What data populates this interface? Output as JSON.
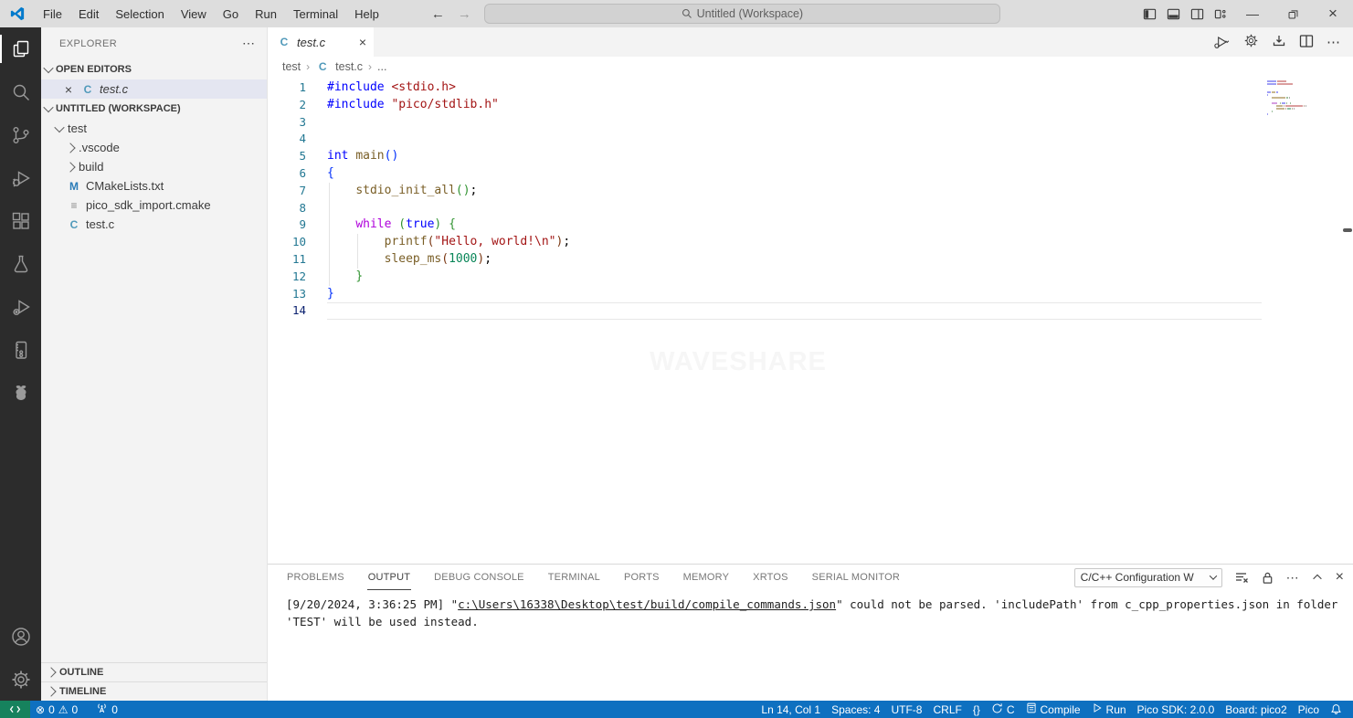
{
  "titlebar": {
    "menus": [
      "File",
      "Edit",
      "Selection",
      "View",
      "Go",
      "Run",
      "Terminal",
      "Help"
    ],
    "command_center": "Untitled (Workspace)"
  },
  "icons": {
    "search_glyph": "⌕",
    "more_horizontal": "⋯",
    "close": "×",
    "minimize": "—",
    "error": "⊗",
    "warning": "⚠",
    "braces": "{}",
    "run_play": "▷",
    "back_arrow": "←",
    "forward_arrow": "→"
  },
  "sidebar": {
    "title": "EXPLORER",
    "open_editors_label": "OPEN EDITORS",
    "workspace_label": "UNTITLED (WORKSPACE)",
    "open_editors": [
      {
        "label": "test.c",
        "icon": "c"
      }
    ],
    "tree": [
      {
        "label": "test",
        "indent": 1,
        "chevron": "down",
        "icon": ""
      },
      {
        "label": ".vscode",
        "indent": 2,
        "chevron": "right",
        "icon": ""
      },
      {
        "label": "build",
        "indent": 2,
        "chevron": "right",
        "icon": ""
      },
      {
        "label": "CMakeLists.txt",
        "indent": 2,
        "chevron": "",
        "icon": "m"
      },
      {
        "label": "pico_sdk_import.cmake",
        "indent": 2,
        "chevron": "",
        "icon": "cmake"
      },
      {
        "label": "test.c",
        "indent": 2,
        "chevron": "",
        "icon": "c"
      }
    ],
    "outline_label": "OUTLINE",
    "timeline_label": "TIMELINE"
  },
  "editor": {
    "tab": {
      "label": "test.c",
      "icon": "c"
    },
    "breadcrumb": [
      "test",
      "test.c",
      "..."
    ],
    "watermark": "WAVESHARE",
    "code_lines": [
      {
        "n": "1",
        "guides": 0,
        "tokens": [
          {
            "t": "#include ",
            "c": "kw"
          },
          {
            "t": "<stdio.h>",
            "c": "str"
          }
        ]
      },
      {
        "n": "2",
        "guides": 0,
        "tokens": [
          {
            "t": "#include ",
            "c": "kw"
          },
          {
            "t": "\"pico/stdlib.h\"",
            "c": "str"
          }
        ]
      },
      {
        "n": "3",
        "guides": 0,
        "tokens": []
      },
      {
        "n": "4",
        "guides": 0,
        "tokens": []
      },
      {
        "n": "5",
        "guides": 0,
        "tokens": [
          {
            "t": "int ",
            "c": "kw"
          },
          {
            "t": "main",
            "c": "fn"
          },
          {
            "t": "()",
            "c": "b1"
          }
        ]
      },
      {
        "n": "6",
        "guides": 0,
        "tokens": [
          {
            "t": "{",
            "c": "b1"
          }
        ]
      },
      {
        "n": "7",
        "guides": 1,
        "tokens": [
          {
            "t": "    ",
            "c": "plain"
          },
          {
            "t": "stdio_init_all",
            "c": "fn"
          },
          {
            "t": "()",
            "c": "b2"
          },
          {
            "t": ";",
            "c": "plain"
          }
        ]
      },
      {
        "n": "8",
        "guides": 1,
        "tokens": []
      },
      {
        "n": "9",
        "guides": 1,
        "tokens": [
          {
            "t": "    ",
            "c": "plain"
          },
          {
            "t": "while",
            "c": "ctrl"
          },
          {
            "t": " ",
            "c": "plain"
          },
          {
            "t": "(",
            "c": "b2"
          },
          {
            "t": "true",
            "c": "kw"
          },
          {
            "t": ")",
            "c": "b2"
          },
          {
            "t": " ",
            "c": "plain"
          },
          {
            "t": "{",
            "c": "b2"
          }
        ]
      },
      {
        "n": "10",
        "guides": 2,
        "tokens": [
          {
            "t": "        ",
            "c": "plain"
          },
          {
            "t": "printf",
            "c": "fn"
          },
          {
            "t": "(",
            "c": "b3"
          },
          {
            "t": "\"Hello, world!\\n\"",
            "c": "str"
          },
          {
            "t": ")",
            "c": "b3"
          },
          {
            "t": ";",
            "c": "plain"
          }
        ]
      },
      {
        "n": "11",
        "guides": 2,
        "tokens": [
          {
            "t": "        ",
            "c": "plain"
          },
          {
            "t": "sleep_ms",
            "c": "fn"
          },
          {
            "t": "(",
            "c": "b3"
          },
          {
            "t": "1000",
            "c": "num"
          },
          {
            "t": ")",
            "c": "b3"
          },
          {
            "t": ";",
            "c": "plain"
          }
        ]
      },
      {
        "n": "12",
        "guides": 1,
        "tokens": [
          {
            "t": "    ",
            "c": "plain"
          },
          {
            "t": "}",
            "c": "b2"
          }
        ]
      },
      {
        "n": "13",
        "guides": 0,
        "tokens": [
          {
            "t": "}",
            "c": "b1"
          }
        ]
      },
      {
        "n": "14",
        "guides": 0,
        "current": true,
        "tokens": []
      }
    ]
  },
  "panel": {
    "tabs": [
      {
        "label": "PROBLEMS"
      },
      {
        "label": "OUTPUT",
        "active": true
      },
      {
        "label": "DEBUG CONSOLE"
      },
      {
        "label": "TERMINAL"
      },
      {
        "label": "PORTS"
      },
      {
        "label": "MEMORY"
      },
      {
        "label": "XRTOS"
      },
      {
        "label": "SERIAL MONITOR"
      }
    ],
    "output_dropdown": "C/C++ Configuration W",
    "output_lines": [
      {
        "pre": "[9/20/2024, 3:36:25 PM] \"",
        "link": "c:\\Users\\16338\\Desktop\\test/build/compile_commands.json",
        "post": "\" could not be parsed. 'includePath' from c_cpp_properties.json in folder"
      },
      {
        "pre": "'TEST' will be used instead.",
        "link": "",
        "post": ""
      }
    ]
  },
  "status_bar": {
    "errors": "0",
    "warnings": "0",
    "ports": "0",
    "right_items": [
      {
        "name": "cursor-position",
        "label": "Ln 14, Col 1"
      },
      {
        "name": "indentation",
        "label": "Spaces: 4"
      },
      {
        "name": "encoding",
        "label": "UTF-8"
      },
      {
        "name": "eol-sequence",
        "label": "CRLF"
      },
      {
        "name": "language-status",
        "label": "{}",
        "glyph": true
      },
      {
        "name": "sync-language",
        "label": "C",
        "icon": "sync"
      },
      {
        "name": "compile-button",
        "label": "Compile",
        "icon": "book"
      },
      {
        "name": "run-button",
        "label": "Run",
        "icon": "play"
      },
      {
        "name": "pico-sdk-version",
        "label": "Pico SDK: 2.0.0"
      },
      {
        "name": "board-selector",
        "label": "Board: pico2"
      },
      {
        "name": "pico-extension",
        "label": "Pico"
      }
    ]
  }
}
